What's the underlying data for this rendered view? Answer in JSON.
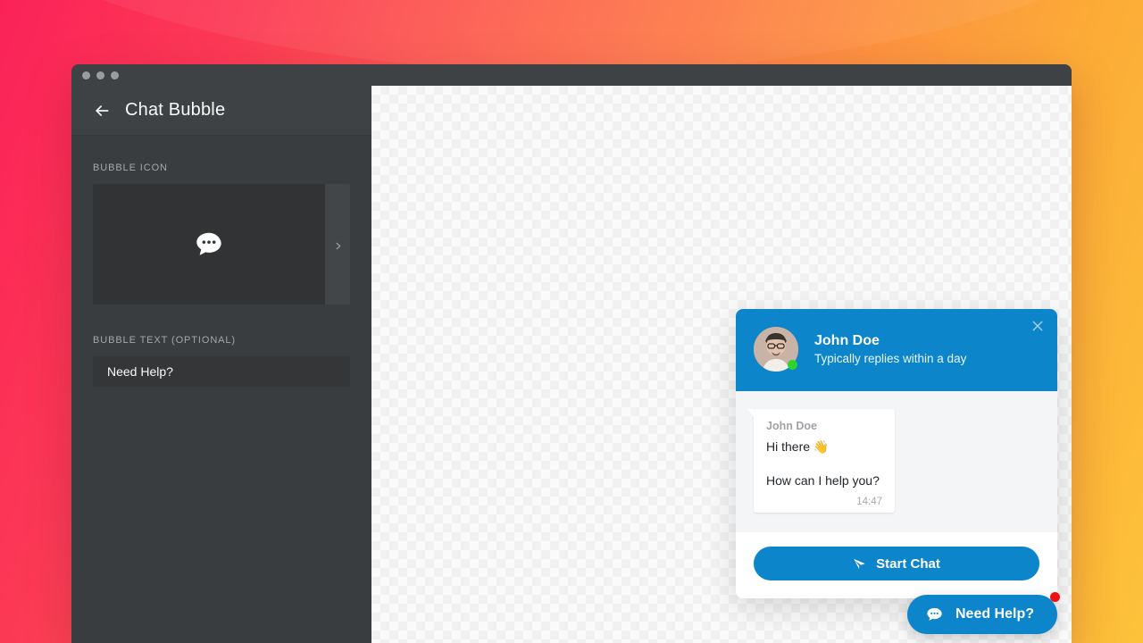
{
  "background": {
    "gradient_start": "#fb2258",
    "gradient_mid": "#fd8b43",
    "gradient_end": "#fdc23a"
  },
  "window": {
    "traffic_lights": [
      "close",
      "minimize",
      "maximize"
    ]
  },
  "sidebar": {
    "header": {
      "back_icon": "back-arrow-icon",
      "title": "Chat Bubble"
    },
    "fields": [
      {
        "label": "BUBBLE ICON",
        "icon_name": "speech-bubble-dots-icon",
        "next_icon": "chevron-right-icon"
      },
      {
        "label": "BUBBLE TEXT (OPTIONAL)",
        "value": "Need Help?",
        "placeholder": "Need Help?"
      }
    ]
  },
  "chat_widget": {
    "header": {
      "agent_name": "John Doe",
      "status": "Typically replies within a day",
      "online": true,
      "close_icon": "close-icon",
      "accent_color": "#0c85ca"
    },
    "messages": [
      {
        "sender": "John Doe",
        "lines": [
          "Hi there 👋",
          "How can I help you?"
        ],
        "time": "14:47"
      }
    ],
    "footer": {
      "button_label": "Start Chat",
      "button_icon": "send-plane-icon"
    }
  },
  "launcher": {
    "icon": "speech-bubble-dots-icon",
    "label": "Need Help?",
    "badge": true,
    "badge_color": "#f01010"
  }
}
